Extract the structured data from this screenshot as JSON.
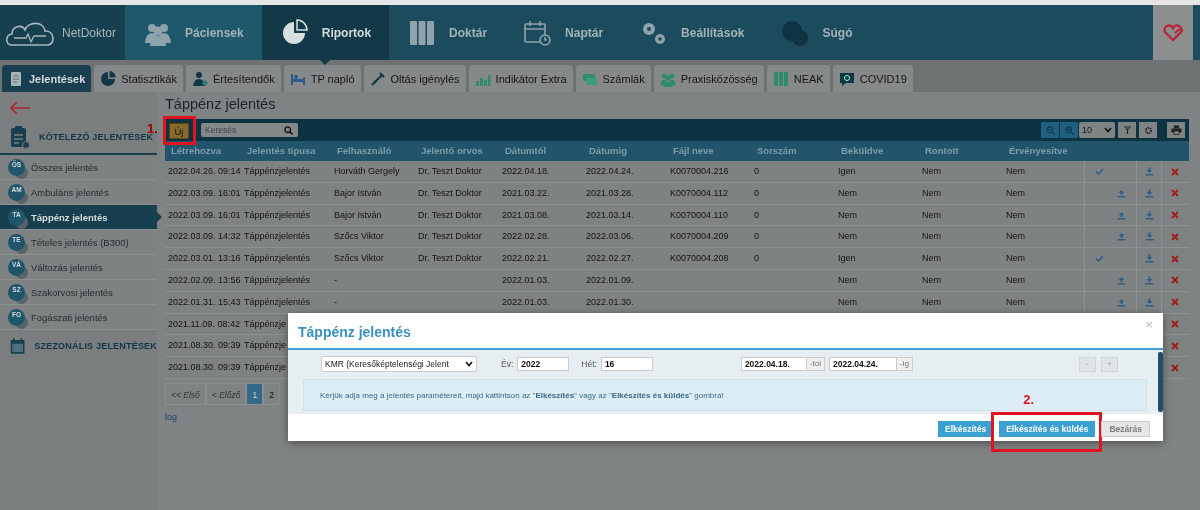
{
  "nav": {
    "logo": "NetDoktor",
    "items": [
      {
        "label": "Páciensek",
        "selected": false
      },
      {
        "label": "Riportok",
        "selected": true
      },
      {
        "label": "Doktár",
        "selected": false
      },
      {
        "label": "Naptár",
        "selected": false
      },
      {
        "label": "Beállítások",
        "selected": false
      },
      {
        "label": "Súgó",
        "selected": false
      }
    ]
  },
  "tabs": [
    {
      "label": "Jelentések",
      "selected": true
    },
    {
      "label": "Statisztikák",
      "selected": false
    },
    {
      "label": "Értesítendők",
      "selected": false
    },
    {
      "label": "TP napló",
      "selected": false
    },
    {
      "label": "Oltás igénylés",
      "selected": false
    },
    {
      "label": "Indikátor Extra",
      "selected": false
    },
    {
      "label": "Számlák",
      "selected": false
    },
    {
      "label": "Praxisközösség",
      "selected": false
    },
    {
      "label": "NEAK",
      "selected": false
    },
    {
      "label": "COVID19",
      "selected": false
    }
  ],
  "sidebar": {
    "sections": [
      {
        "title": "KÖTELEZŐ JELENTÉSEK",
        "items": [
          {
            "badge": "ÖS",
            "label": "Összes jelentés",
            "selected": false
          },
          {
            "badge": "AM",
            "label": "Ambuláns jelentés",
            "selected": false
          },
          {
            "badge": "TA",
            "label": "Táppénz jelentés",
            "selected": true
          },
          {
            "badge": "TE",
            "label": "Tételes jelentés (B300)",
            "selected": false
          },
          {
            "badge": "VÁ",
            "label": "Változás jelentés",
            "selected": false
          },
          {
            "badge": "SZ",
            "label": "Szakorvosi jelentés",
            "selected": false
          },
          {
            "badge": "FO",
            "label": "Fogászati jelentés",
            "selected": false
          }
        ]
      },
      {
        "title": "SZEZONÁLIS JELENTÉSEK"
      }
    ]
  },
  "report": {
    "title": "Táppénz jelentés",
    "toolbar": {
      "new_button": {
        "label": "Új",
        "step": "1."
      },
      "search": {
        "placeholder": "Keresés"
      },
      "page_size": "10"
    },
    "table": {
      "columns": [
        "Létrehozva",
        "Jelentés típusa",
        "Felhasználó",
        "Jelentő orvos",
        "Dátumtól",
        "Dátumig",
        "Fájl neve",
        "Sorszám",
        "Beküldve",
        "Rontott",
        "Érvényesítve"
      ],
      "rows": [
        {
          "cells": [
            "2022.04.26. 09:14",
            "Táppénzjelentés",
            "Horváth Gergely",
            "Dr. Teszt Doktor",
            "2022.04.18.",
            "2022.04.24.",
            "K0070004.216",
            "0",
            "Igen",
            "Nem",
            "Nem"
          ],
          "actions": [
            {
              "kind": "check"
            },
            {
              "kind": "download"
            },
            {
              "kind": "delete"
            }
          ]
        },
        {
          "cells": [
            "2022.03.09. 16:01",
            "Táppénzjelentés",
            "Bajor István",
            "Dr. Teszt Doktor",
            "2021.03.22.",
            "2021.03.28.",
            "K0070004.112",
            "0",
            "Nem",
            "Nem",
            "Nem"
          ],
          "actions": [
            {
              "kind": "upload"
            },
            {
              "kind": "download"
            },
            {
              "kind": "delete"
            }
          ]
        },
        {
          "cells": [
            "2022.03.09. 16:01",
            "Táppénzjelentés",
            "Bajor István",
            "Dr. Teszt Doktor",
            "2021.03.08.",
            "2021.03.14.",
            "K0070004.110",
            "0",
            "Nem",
            "Nem",
            "Nem"
          ],
          "actions": [
            {
              "kind": "upload"
            },
            {
              "kind": "download"
            },
            {
              "kind": "delete"
            }
          ]
        },
        {
          "cells": [
            "2022.03.09. 14:32",
            "Táppénzjelentés",
            "Szőcs Viktor",
            "Dr. Teszt Doktor",
            "2022.02.28.",
            "2022.03.06.",
            "K0070004.209",
            "0",
            "Nem",
            "Nem",
            "Nem"
          ],
          "actions": [
            {
              "kind": "upload"
            },
            {
              "kind": "download"
            },
            {
              "kind": "delete"
            }
          ]
        },
        {
          "cells": [
            "2022.03.01. 13:16",
            "Táppénzjelentés",
            "Szőcs Viktor",
            "Dr. Teszt Doktor",
            "2022.02.21.",
            "2022.02.27.",
            "K0070004.208",
            "0",
            "Igen",
            "Nem",
            "Nem"
          ],
          "actions": [
            {
              "kind": "check"
            },
            {
              "kind": "download"
            },
            {
              "kind": "delete"
            }
          ]
        },
        {
          "cells": [
            "2022.02.09. 13:56",
            "Táppénzjelentés",
            "-",
            "",
            "2022.01.03.",
            "2022.01.09.",
            "",
            "",
            "Nem",
            "Nem",
            "Nem"
          ],
          "actions": [
            {
              "kind": "upload"
            },
            {
              "kind": "download"
            },
            {
              "kind": "delete"
            }
          ]
        },
        {
          "cells": [
            "2022.01.31. 15:43",
            "Táppénzjelentés",
            "-",
            "",
            "2022.01.03.",
            "2022.01.30.",
            "",
            "",
            "Nem",
            "Nem",
            "Nem"
          ],
          "actions": [
            {
              "kind": "upload"
            },
            {
              "kind": "download"
            },
            {
              "kind": "delete"
            }
          ]
        },
        {
          "cells": [
            "2021.11.09. 08:42",
            "Táppénzje"
          ],
          "actions": [
            {
              "kind": "delete"
            }
          ]
        },
        {
          "cells": [
            "2021.08.30. 09:39",
            "Táppénzje"
          ],
          "actions": [
            {
              "kind": "delete"
            }
          ]
        },
        {
          "cells": [
            "2021.08.30. 09:39",
            "Táppénzje"
          ],
          "actions": [
            {
              "kind": "delete"
            }
          ]
        }
      ]
    },
    "pagination": [
      {
        "label": "<< Első",
        "selected": false,
        "disabled": true
      },
      {
        "label": "< Előző",
        "selected": false,
        "disabled": true
      },
      {
        "label": "1",
        "selected": true,
        "disabled": false
      },
      {
        "label": "2",
        "selected": false,
        "disabled": false
      }
    ],
    "link": "log"
  },
  "modal": {
    "title": "Táppénz jelentés",
    "close": "×",
    "report_type": "KMR (Keresőképtelenségi Jelent",
    "year": {
      "label": "Év:",
      "value": "2022"
    },
    "week": {
      "label": "Hét:",
      "value": "16"
    },
    "from": {
      "value": "2022.04.18.",
      "suffix": "-tól"
    },
    "to": {
      "value": "2022.04.24.",
      "suffix": "-ig"
    },
    "steppers": [
      "-",
      "+"
    ],
    "info": "Kérjük adja meg a jelentés paramétereit, majd kattintson az \"**Elkészítés**\" vagy az \"**Elkészítés és küldés**\" gombra!",
    "buttons": [
      {
        "label": "Elkészítés",
        "disabled": false
      },
      {
        "label": "Elkészítés és küldés",
        "disabled": false,
        "step": "2."
      },
      {
        "label": "Bezárás",
        "disabled": true
      }
    ]
  }
}
